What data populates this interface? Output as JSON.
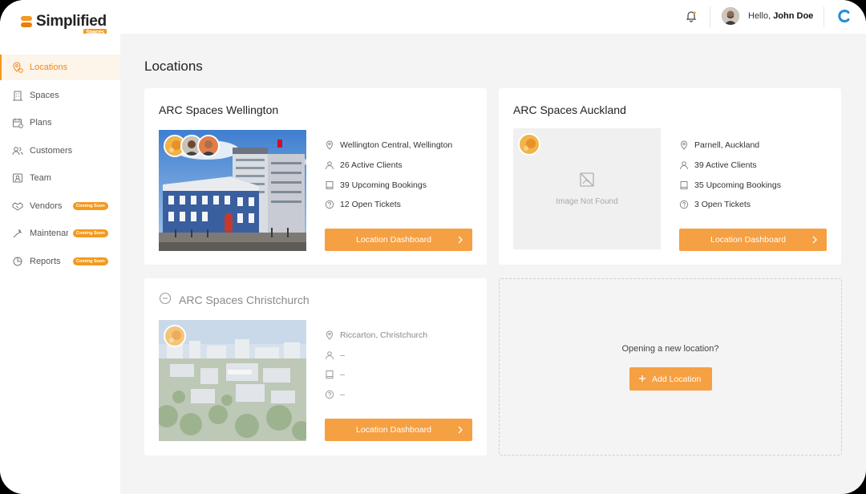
{
  "app": {
    "logo_text": "Simplified",
    "logo_sub": "Spaces",
    "greeting": "Hello,",
    "user_name": "John Doe",
    "accent": "#f5a043"
  },
  "sidebar": {
    "items": [
      {
        "label": "Locations",
        "icon": "location-pin-icon",
        "active": true
      },
      {
        "label": "Spaces",
        "icon": "building-icon"
      },
      {
        "label": "Plans",
        "icon": "calendar-icon"
      },
      {
        "label": "Customers",
        "icon": "users-icon"
      },
      {
        "label": "Team",
        "icon": "id-card-icon"
      },
      {
        "label": "Vendors",
        "icon": "handshake-icon",
        "badge": "Coming Soon"
      },
      {
        "label": "Maintenance",
        "icon": "wrench-icon",
        "badge": "Coming Soon"
      },
      {
        "label": "Reports",
        "icon": "pie-chart-icon",
        "badge": "Coming Soon"
      }
    ]
  },
  "main": {
    "title": "Locations",
    "cards": [
      {
        "title": "ARC Spaces Wellington",
        "address": "Wellington Central, Wellington",
        "clients": "26 Active Clients",
        "bookings": "39 Upcoming Bookings",
        "tickets": "12 Open Tickets",
        "button": "Location Dashboard"
      },
      {
        "title": "ARC Spaces Auckland",
        "image_missing": "Image Not Found",
        "address": "Parnell, Auckland",
        "clients": "39 Active Clients",
        "bookings": "35 Upcoming Bookings",
        "tickets": "3 Open Tickets",
        "button": "Location Dashboard"
      },
      {
        "title": "ARC Spaces Christchurch",
        "disabled": true,
        "address": "Riccarton, Christchurch",
        "clients": "–",
        "bookings": "–",
        "tickets": "–",
        "button": "Location Dashboard"
      }
    ],
    "add": {
      "prompt": "Opening a new location?",
      "button": "Add Location"
    }
  }
}
